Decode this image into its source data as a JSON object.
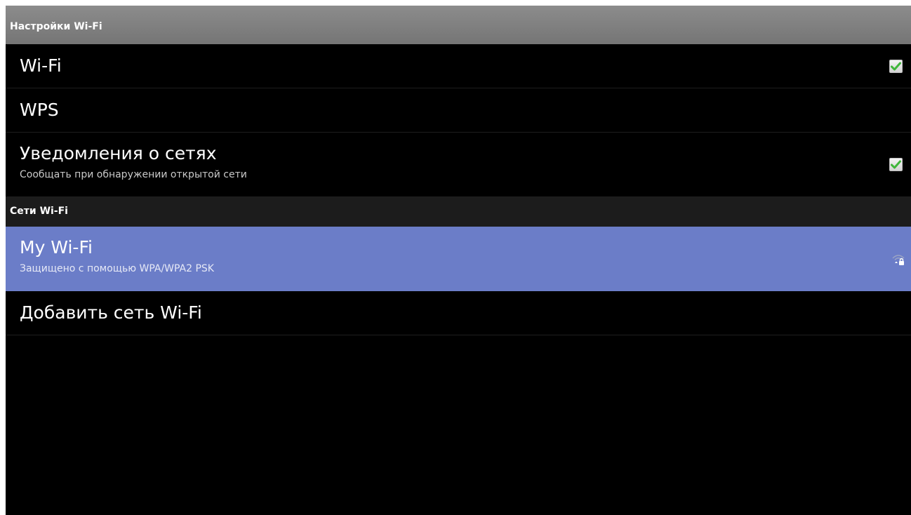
{
  "header": {
    "title": "Настройки Wi-Fi"
  },
  "settings": {
    "wifi": {
      "title": "Wi-Fi",
      "checked": true
    },
    "wps": {
      "title": "WPS"
    },
    "notifications": {
      "title": "Уведомления о сетях",
      "subtitle": "Сообщать при обнаружении открытой сети",
      "checked": true
    }
  },
  "networks_section": {
    "title": "Сети Wi-Fi"
  },
  "networks": [
    {
      "name": "My Wi-Fi",
      "security": "Защищено с помощью WPA/WPA2 PSK",
      "icon": "wifi-lock-icon"
    }
  ],
  "add_network": {
    "label": "Добавить сеть Wi-Fi"
  },
  "colors": {
    "accent_selected": "#6b7dc8",
    "check_green": "#3fb63a",
    "background": "#000000"
  }
}
